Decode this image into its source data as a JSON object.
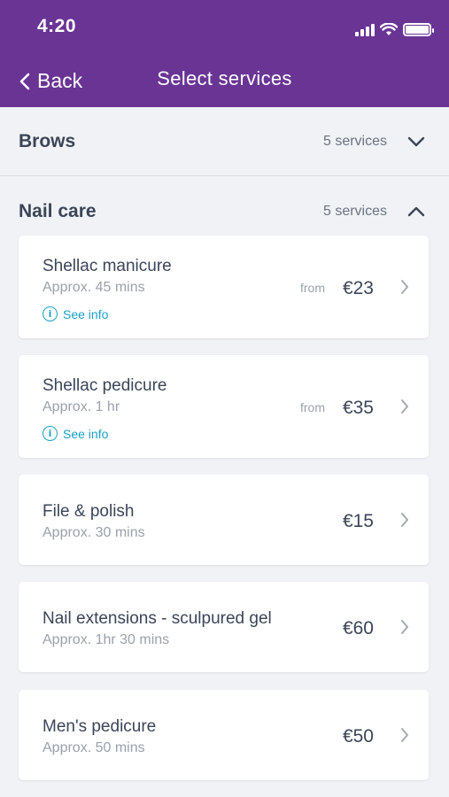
{
  "status_bar": {
    "time": "4:20"
  },
  "nav": {
    "back_label": "Back",
    "title": "Select services"
  },
  "categories": [
    {
      "name": "Brows",
      "count": "5 services",
      "expanded": false
    },
    {
      "name": "Nail care",
      "count": "5 services",
      "expanded": true
    }
  ],
  "services": [
    {
      "name": "Shellac manicure",
      "duration": "Approx. 45 mins",
      "from": "from",
      "price": "€23",
      "info": "See info"
    },
    {
      "name": "Shellac pedicure",
      "duration": "Approx. 1 hr",
      "from": "from",
      "price": "€35",
      "info": "See info"
    },
    {
      "name": "File & polish",
      "duration": "Approx. 30 mins",
      "price": "€15"
    },
    {
      "name": "Nail extensions - sculpured gel",
      "duration": "Approx. 1hr 30 mins",
      "price": "€60"
    },
    {
      "name": "Men's pedicure",
      "duration": "Approx. 50 mins",
      "price": "€50"
    }
  ],
  "colors": {
    "header": "#6a3495",
    "accent_info": "#1aa0c8",
    "background": "#f0f2f5"
  }
}
